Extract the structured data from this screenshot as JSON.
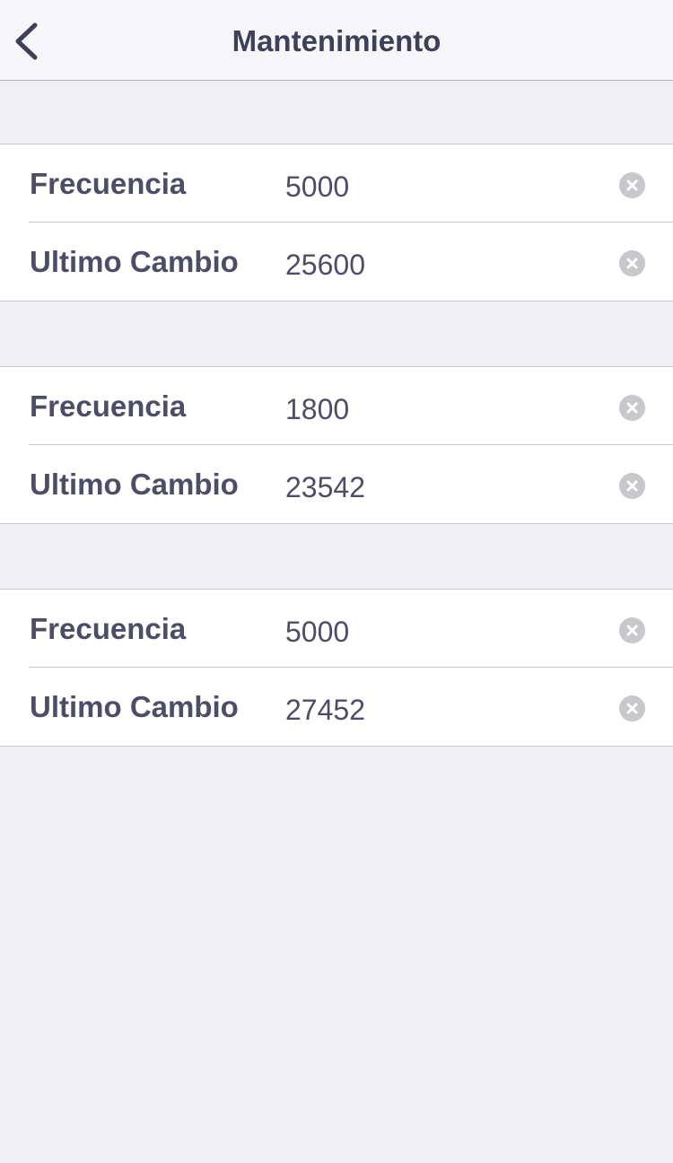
{
  "navbar": {
    "title": "Mantenimiento",
    "back_icon": "chevron-left-icon"
  },
  "sections": [
    {
      "rows": [
        {
          "label": "Frecuencia",
          "value": "5000"
        },
        {
          "label": "Ultimo Cambio",
          "value": "25600"
        }
      ]
    },
    {
      "rows": [
        {
          "label": "Frecuencia",
          "value": "1800"
        },
        {
          "label": "Ultimo Cambio",
          "value": "23542"
        }
      ]
    },
    {
      "rows": [
        {
          "label": "Frecuencia",
          "value": "5000"
        },
        {
          "label": "Ultimo Cambio",
          "value": "27452"
        }
      ]
    }
  ],
  "colors": {
    "background": "#EFEFF4",
    "navbar": "#F6F6F8",
    "text": "#4D4D66",
    "clear_icon": "#C7C7CC"
  }
}
